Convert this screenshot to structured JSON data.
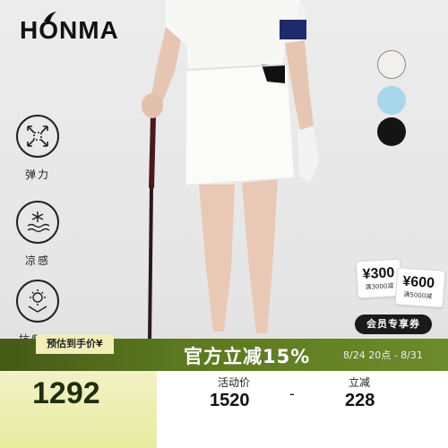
{
  "brand": {
    "logo_text": "HONMA"
  },
  "features": [
    {
      "icon": "stretch-arrows-icon",
      "label": "弹力"
    },
    {
      "icon": "snowflake-cooling-icon",
      "label": "凉感"
    },
    {
      "icon": "sun-protection-icon",
      "label": "抗紫外线"
    }
  ],
  "colors": [
    "#f1f0ec",
    "#a8d6ea",
    "#141414"
  ],
  "coupons": [
    {
      "amount": "¥300",
      "condition": "满3000减"
    },
    {
      "amount": "¥600",
      "condition": "满5000减"
    }
  ],
  "member_button": "会员专享券",
  "promo": {
    "presale_label": "预估到手价¥",
    "final_price": "1292",
    "title": "官方立减15%",
    "date_range": "8/24 20点 - 8/31",
    "activity_label": "活动价",
    "activity_price": "1520",
    "discount_label": "立减",
    "discount_value": "228",
    "separator": "-"
  }
}
